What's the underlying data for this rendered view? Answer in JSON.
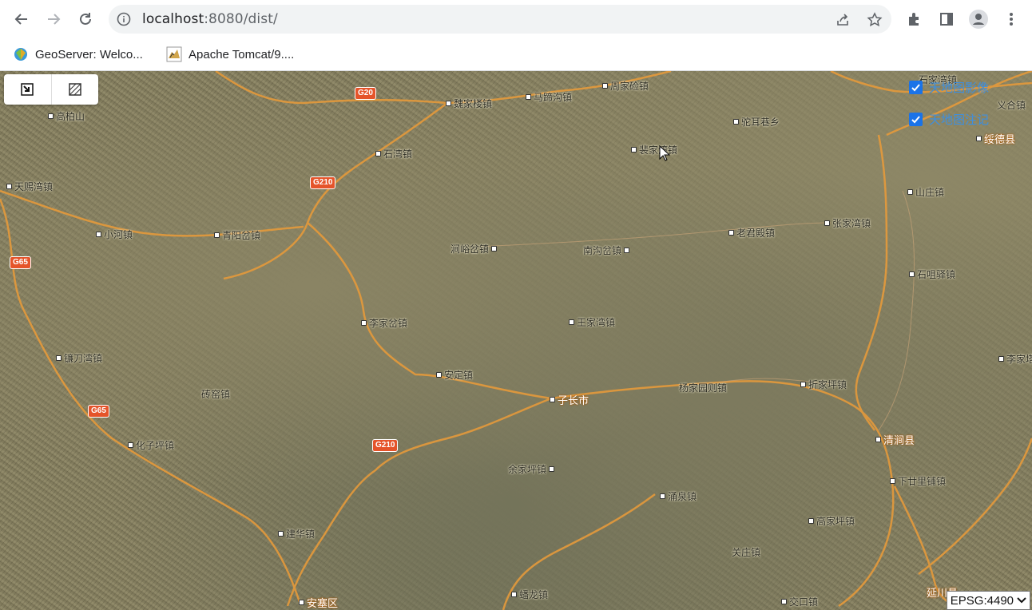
{
  "browser": {
    "url_host": "localhost",
    "url_rest": ":8080/dist/",
    "bookmarks": [
      {
        "label": "GeoServer: Welco...",
        "icon": "geoserver-icon"
      },
      {
        "label": "Apache Tomcat/9....",
        "icon": "tomcat-icon"
      }
    ]
  },
  "map": {
    "layers": [
      {
        "label": "天地图影像",
        "checked": true
      },
      {
        "label": "天地图注记",
        "checked": true
      }
    ],
    "crs": {
      "selected": "EPSG:4490"
    },
    "places": [
      {
        "name": "高柏山",
        "type": "town"
      },
      {
        "name": "G20",
        "type": "shield"
      },
      {
        "name": "魏家楼镇",
        "type": "town"
      },
      {
        "name": "马蹄沟镇",
        "type": "town"
      },
      {
        "name": "周家硷镇",
        "type": "town"
      },
      {
        "name": "石家湾镇",
        "type": "town"
      },
      {
        "name": "义合镇",
        "type": "town"
      },
      {
        "name": "驼耳巷乡",
        "type": "town"
      },
      {
        "name": "石湾镇",
        "type": "town"
      },
      {
        "name": "裴家湾镇",
        "type": "town"
      },
      {
        "name": "绥德县",
        "type": "city"
      },
      {
        "name": "G210",
        "type": "shield"
      },
      {
        "name": "天赐湾镇",
        "type": "town"
      },
      {
        "name": "山庄镇",
        "type": "town"
      },
      {
        "name": "小河镇",
        "type": "town"
      },
      {
        "name": "青阳岔镇",
        "type": "town"
      },
      {
        "name": "老君殿镇",
        "type": "town"
      },
      {
        "name": "张家湾镇",
        "type": "town"
      },
      {
        "name": "G65",
        "type": "shield"
      },
      {
        "name": "涧峪岔镇",
        "type": "town"
      },
      {
        "name": "南沟岔镇",
        "type": "town"
      },
      {
        "name": "石咀驿镇",
        "type": "town"
      },
      {
        "name": "李家岔镇",
        "type": "town"
      },
      {
        "name": "王家湾镇",
        "type": "town"
      },
      {
        "name": "镰刀湾镇",
        "type": "town"
      },
      {
        "name": "安定镇",
        "type": "town"
      },
      {
        "name": "子长市",
        "type": "city"
      },
      {
        "name": "杨家园则镇",
        "type": "town"
      },
      {
        "name": "折家坪镇",
        "type": "town"
      },
      {
        "name": "李家塔",
        "type": "town"
      },
      {
        "name": "砖窑镇",
        "type": "town"
      },
      {
        "name": "清涧县",
        "type": "city"
      },
      {
        "name": "化子坪镇",
        "type": "town"
      },
      {
        "name": "余家坪镇",
        "type": "town"
      },
      {
        "name": "下廿里铺镇",
        "type": "town"
      },
      {
        "name": "涌泉镇",
        "type": "town"
      },
      {
        "name": "高家坪镇",
        "type": "town"
      },
      {
        "name": "建华镇",
        "type": "town"
      },
      {
        "name": "关庄镇",
        "type": "town"
      },
      {
        "name": "蟠龙镇",
        "type": "town"
      },
      {
        "name": "安塞区",
        "type": "city"
      },
      {
        "name": "交口镇",
        "type": "town"
      },
      {
        "name": "延川县",
        "type": "city"
      }
    ]
  }
}
